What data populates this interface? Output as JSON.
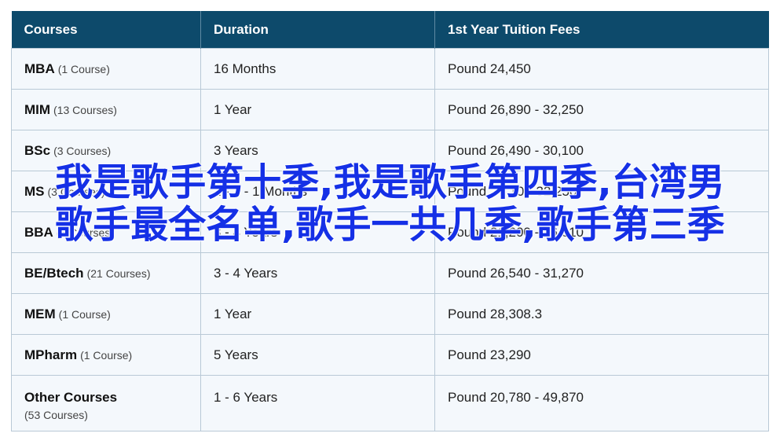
{
  "table": {
    "headers": [
      "Courses",
      "Duration",
      "1st Year Tuition Fees"
    ],
    "rows": [
      {
        "course": "MBA",
        "count": "(1 Course)",
        "duration": "16 Months",
        "fee": "Pound 24,450"
      },
      {
        "course": "MIM",
        "count": "(13 Courses)",
        "duration": "1 Year",
        "fee": "Pound 26,890 - 32,250"
      },
      {
        "course": "BSc",
        "count": "(3 Courses)",
        "duration": "3 Years",
        "fee": "Pound 26,490 - 30,100"
      },
      {
        "course": "MS",
        "count": "(3 Courses)",
        "duration": "1 - 2 - 1 Months",
        "fee": "Pound 2 - 10 - 32,250"
      },
      {
        "course": "BBA",
        "count": "(3 Courses)",
        "duration": "3 - 4 Years",
        "fee": "Pound 21,200 - 26,610"
      },
      {
        "course": "BE/Btech",
        "count": "(21 Courses)",
        "duration": "3 - 4 Years",
        "fee": "Pound 26,540 - 31,270"
      },
      {
        "course": "MEM",
        "count": "(1 Course)",
        "duration": "1 Year",
        "fee": "Pound 28,308.3"
      },
      {
        "course": "MPharm",
        "count": "(1 Course)",
        "duration": "5 Years",
        "fee": "Pound 23,290"
      },
      {
        "course": "Other Courses",
        "count": "(53 Courses)",
        "duration": "1 - 6 Years",
        "fee": "Pound 20,780 - 49,870"
      }
    ]
  },
  "overlay_text": "我是歌手第十季,我是歌手第四季,台湾男歌手最全名单,歌手一共几季,歌手第三季",
  "colors": {
    "header_bg": "#0d4a6b",
    "row_bg": "#f4f8fc",
    "overlay": "#1530e6"
  }
}
